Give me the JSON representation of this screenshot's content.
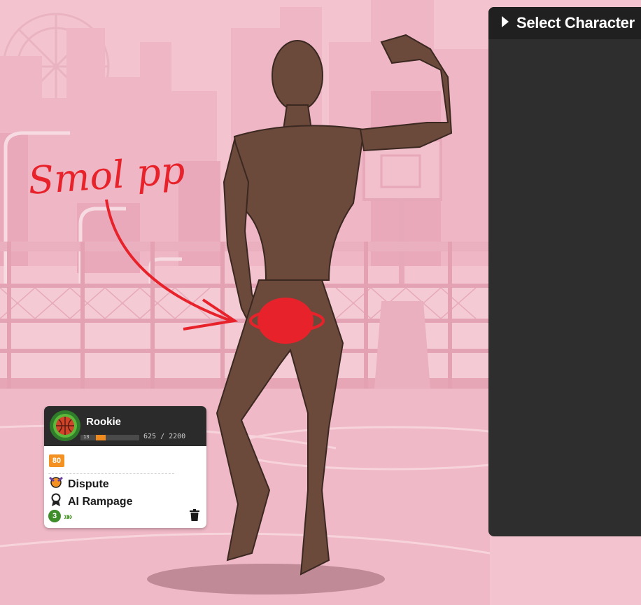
{
  "annotation": {
    "text": "Smol pp"
  },
  "panel": {
    "title": "Select Character"
  },
  "card": {
    "rank": "Rookie",
    "level": "13",
    "xp": 625,
    "xp_max": 2200,
    "xp_text": "625 / 2200",
    "rating": "80",
    "trait_1": "Dispute",
    "trait_2": "AI Rampage",
    "streak": "3"
  },
  "colors": {
    "background": "#f2c0cc",
    "panel": "#2e2e2e",
    "accent_orange": "#f39222",
    "streak_green": "#3f8c2a",
    "annotation_red": "#e8222a",
    "skin": "#6b4a3c"
  },
  "icons": {
    "panel": "play-triangle-icon",
    "rank": "basketball-rank-icon",
    "trait_1": "dispute-icon",
    "trait_2": "award-ribbon-icon",
    "delete": "trash-icon"
  }
}
